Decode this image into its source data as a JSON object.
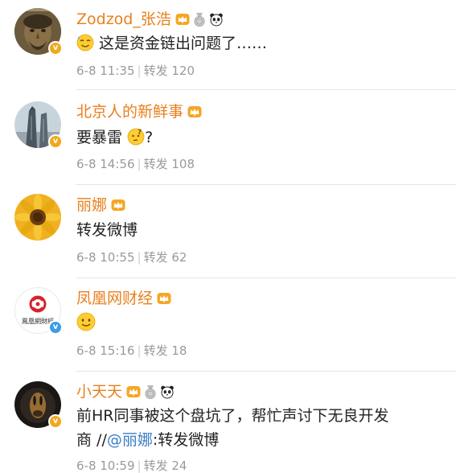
{
  "comments": [
    {
      "username": "Zodzod_张浩",
      "content_text": "这是资金链出问题了……",
      "date": "6-8 11:35",
      "repost_label": "转发",
      "repost_count": "120",
      "verified": "gold"
    },
    {
      "username": "北京人的新鲜事",
      "content_text": "要暴雷",
      "content_suffix": "?",
      "date": "6-8 14:56",
      "repost_label": "转发",
      "repost_count": "108",
      "verified": "gold"
    },
    {
      "username": "丽娜",
      "content_text": "转发微博",
      "date": "6-8 10:55",
      "repost_label": "转发",
      "repost_count": "62"
    },
    {
      "username": "凤凰网财经",
      "content_text": "",
      "date": "6-8 15:16",
      "repost_label": "转发",
      "repost_count": "18",
      "verified": "blue",
      "avatar_text": "鳳凰網財經"
    },
    {
      "username": "小天天",
      "content_line1": "前HR同事被这个盘坑了，帮忙声讨下无良开发",
      "content_line2_prefix": "商 //",
      "mention": "@丽娜",
      "content_line2_suffix": ":转发微博",
      "date": "6-8 10:59",
      "repost_label": "转发",
      "repost_count": "24",
      "verified": "gold"
    }
  ],
  "colors": {
    "username": "#e8801e",
    "mention": "#3b7fc4",
    "meta": "#9a9a9a",
    "verified_gold": "#f0a81c",
    "verified_blue": "#3c9be8"
  },
  "icons": {
    "crown_badge": "crown-badge-icon",
    "medal_badge": "medal-badge-icon",
    "panda_badge": "panda-badge-icon",
    "verified_badge": "verified-v-icon",
    "emoji_sweat": "sweat-emoji-icon",
    "emoji_thinking": "thinking-emoji-icon",
    "emoji_smile": "smile-emoji-icon"
  }
}
